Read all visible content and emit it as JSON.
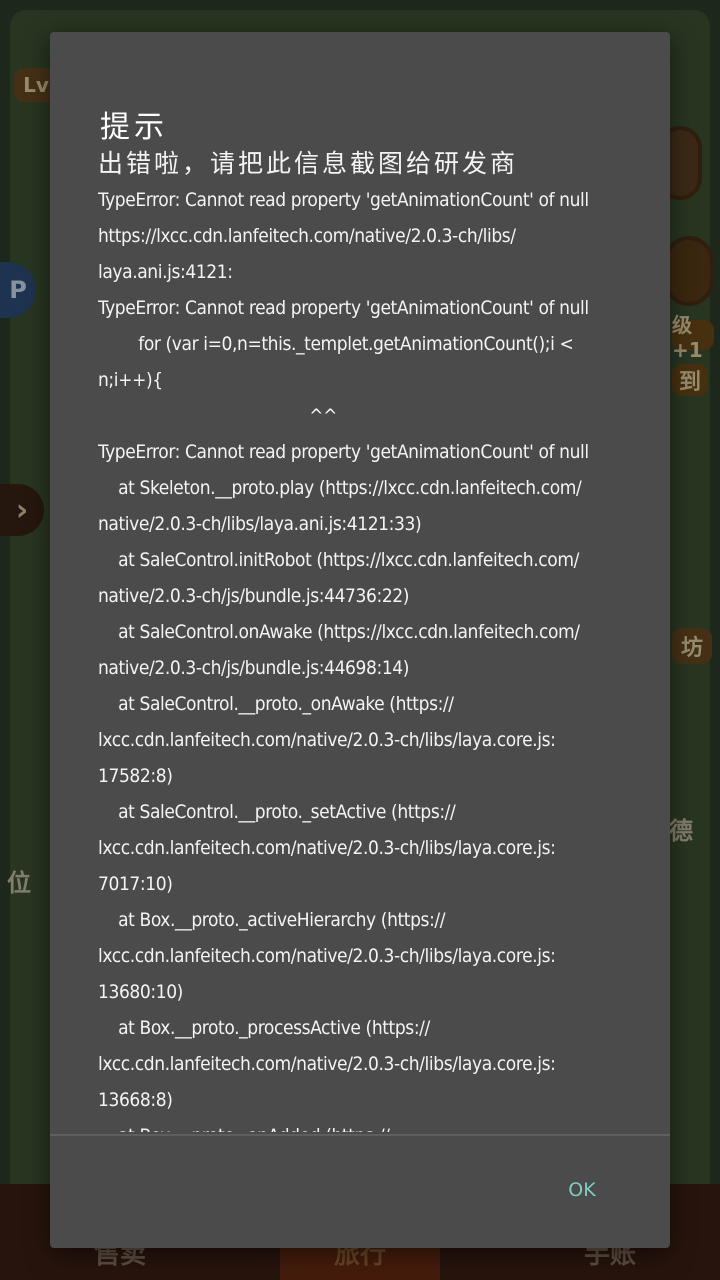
{
  "dialog": {
    "title": "提示",
    "heading": "出错啦，请把此信息截图给研发商",
    "lines": [
      "TypeError: Cannot read property 'getAnimationCount' of null",
      "https://lxcc.cdn.lanfeitech.com/native/2.0.3-ch/libs/",
      "laya.ani.js:4121:",
      "TypeError: Cannot read property 'getAnimationCount' of null",
      "        for (var i=0,n=this._templet.getAnimationCount();i <",
      "n;i++){",
      "                                          ^^",
      "TypeError: Cannot read property 'getAnimationCount' of null",
      "    at Skeleton.__proto.play (https://lxcc.cdn.lanfeitech.com/",
      "native/2.0.3-ch/libs/laya.ani.js:4121:33)",
      "    at SaleControl.initRobot (https://lxcc.cdn.lanfeitech.com/",
      "native/2.0.3-ch/js/bundle.js:44736:22)",
      "    at SaleControl.onAwake (https://lxcc.cdn.lanfeitech.com/",
      "native/2.0.3-ch/js/bundle.js:44698:14)",
      "    at SaleControl.__proto._onAwake (https://",
      "lxcc.cdn.lanfeitech.com/native/2.0.3-ch/libs/laya.core.js:",
      "17582:8)",
      "    at SaleControl.__proto._setActive (https://",
      "lxcc.cdn.lanfeitech.com/native/2.0.3-ch/libs/laya.core.js:",
      "7017:10)",
      "    at Box.__proto._activeHierarchy (https://",
      "lxcc.cdn.lanfeitech.com/native/2.0.3-ch/libs/laya.core.js:",
      "13680:10)",
      "    at Box.__proto._processActive (https://",
      "lxcc.cdn.lanfeitech.com/native/2.0.3-ch/libs/laya.core.js:",
      "13668:8)",
      "    at Box.__proto._onAdded (https://"
    ],
    "ok_label": "OK"
  },
  "background": {
    "level_badge": "Lv",
    "left_button": "P",
    "arrow_glyph": "›",
    "right_labels": [
      "级+1",
      "到",
      "坊",
      "德"
    ],
    "left_label": "位",
    "bottom_tabs": [
      "售卖",
      "旅行",
      "手账"
    ]
  },
  "colors": {
    "dialog_bg": "#4b4b4b",
    "accent": "#80cbc4",
    "text": "#f4f4f4"
  }
}
